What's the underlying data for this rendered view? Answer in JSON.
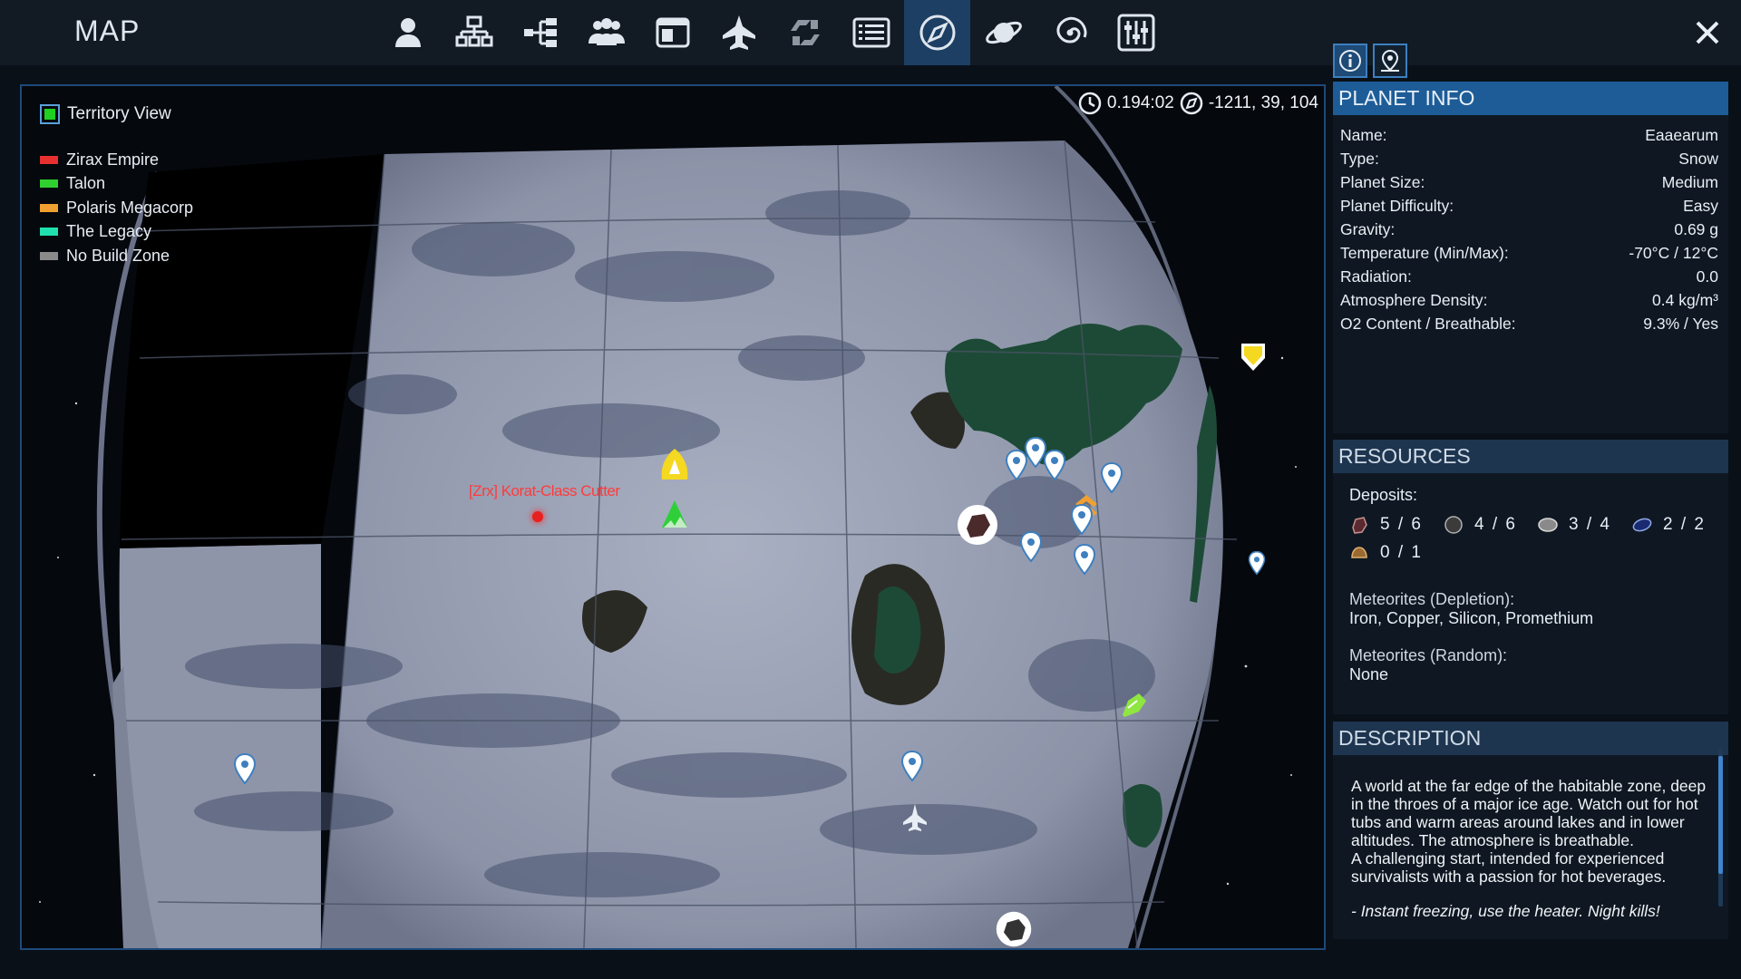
{
  "header": {
    "title": "MAP",
    "tabs": [
      {
        "icon": "player-icon"
      },
      {
        "icon": "structures-icon"
      },
      {
        "icon": "tech-tree-icon"
      },
      {
        "icon": "faction-icon"
      },
      {
        "icon": "registry-icon"
      },
      {
        "icon": "ship-icon"
      },
      {
        "icon": "trade-icon"
      },
      {
        "icon": "list-icon"
      },
      {
        "icon": "compass-icon",
        "active": true
      },
      {
        "icon": "planet-icon"
      },
      {
        "icon": "galaxy-icon"
      },
      {
        "icon": "settings-icon"
      }
    ],
    "close_icon": "close-icon"
  },
  "map": {
    "territory_view_label": "Territory View",
    "territory_view_checked": true,
    "legend": [
      {
        "label": "Zirax Empire",
        "color": "#e83030"
      },
      {
        "label": "Talon",
        "color": "#2fd02f"
      },
      {
        "label": "Polaris Megacorp",
        "color": "#f0a030"
      },
      {
        "label": "The Legacy",
        "color": "#20e0b0"
      },
      {
        "label": "No Build Zone",
        "color": "#8a8a8a"
      }
    ],
    "time": "0.194:02",
    "coords": "-1211, 39, 104",
    "ship_label": "[Zrx] Korat-Class Cutter"
  },
  "planet_info": {
    "title": "PLANET INFO",
    "rows": [
      {
        "key": "Name:",
        "value": "Eaaearum"
      },
      {
        "key": "Type:",
        "value": "Snow"
      },
      {
        "key": "Planet Size:",
        "value": "Medium"
      },
      {
        "key": "Planet Difficulty:",
        "value": "Easy"
      },
      {
        "key": "Gravity:",
        "value": "0.69 g"
      },
      {
        "key": "Temperature (Min/Max):",
        "value": "-70°C / 12°C"
      },
      {
        "key": "Radiation:",
        "value": "0.0"
      },
      {
        "key": "Atmosphere Density:",
        "value": "0.4 kg/m³"
      },
      {
        "key": "O2 Content / Breathable:",
        "value": "9.3% / Yes"
      }
    ]
  },
  "resources": {
    "title": "RESOURCES",
    "deposits_label": "Deposits:",
    "deposits": [
      {
        "icon": "iron-ore-icon",
        "value": "5 / 6"
      },
      {
        "icon": "copper-ore-icon",
        "value": "4 / 6"
      },
      {
        "icon": "silicon-ore-icon",
        "value": "3 / 4"
      },
      {
        "icon": "promethium-ore-icon",
        "value": "2 / 2"
      },
      {
        "icon": "sathium-ore-icon",
        "value": "0 / 1"
      }
    ],
    "met_depletion_label": "Meteorites (Depletion):",
    "met_depletion_value": "Iron, Copper, Silicon, Promethium",
    "met_random_label": "Meteorites (Random):",
    "met_random_value": "None"
  },
  "description": {
    "title": "DESCRIPTION",
    "p1": "A world at the far edge of the habitable zone, deep in the throes of a major ice age. Watch out for hot tubs and warm areas around lakes and in lower altitudes. The atmosphere is breathable.",
    "p2": "A challenging start, intended for experienced survivalists with a passion for hot beverages.",
    "p3": "- Instant freezing, use the heater. Night kills!"
  }
}
